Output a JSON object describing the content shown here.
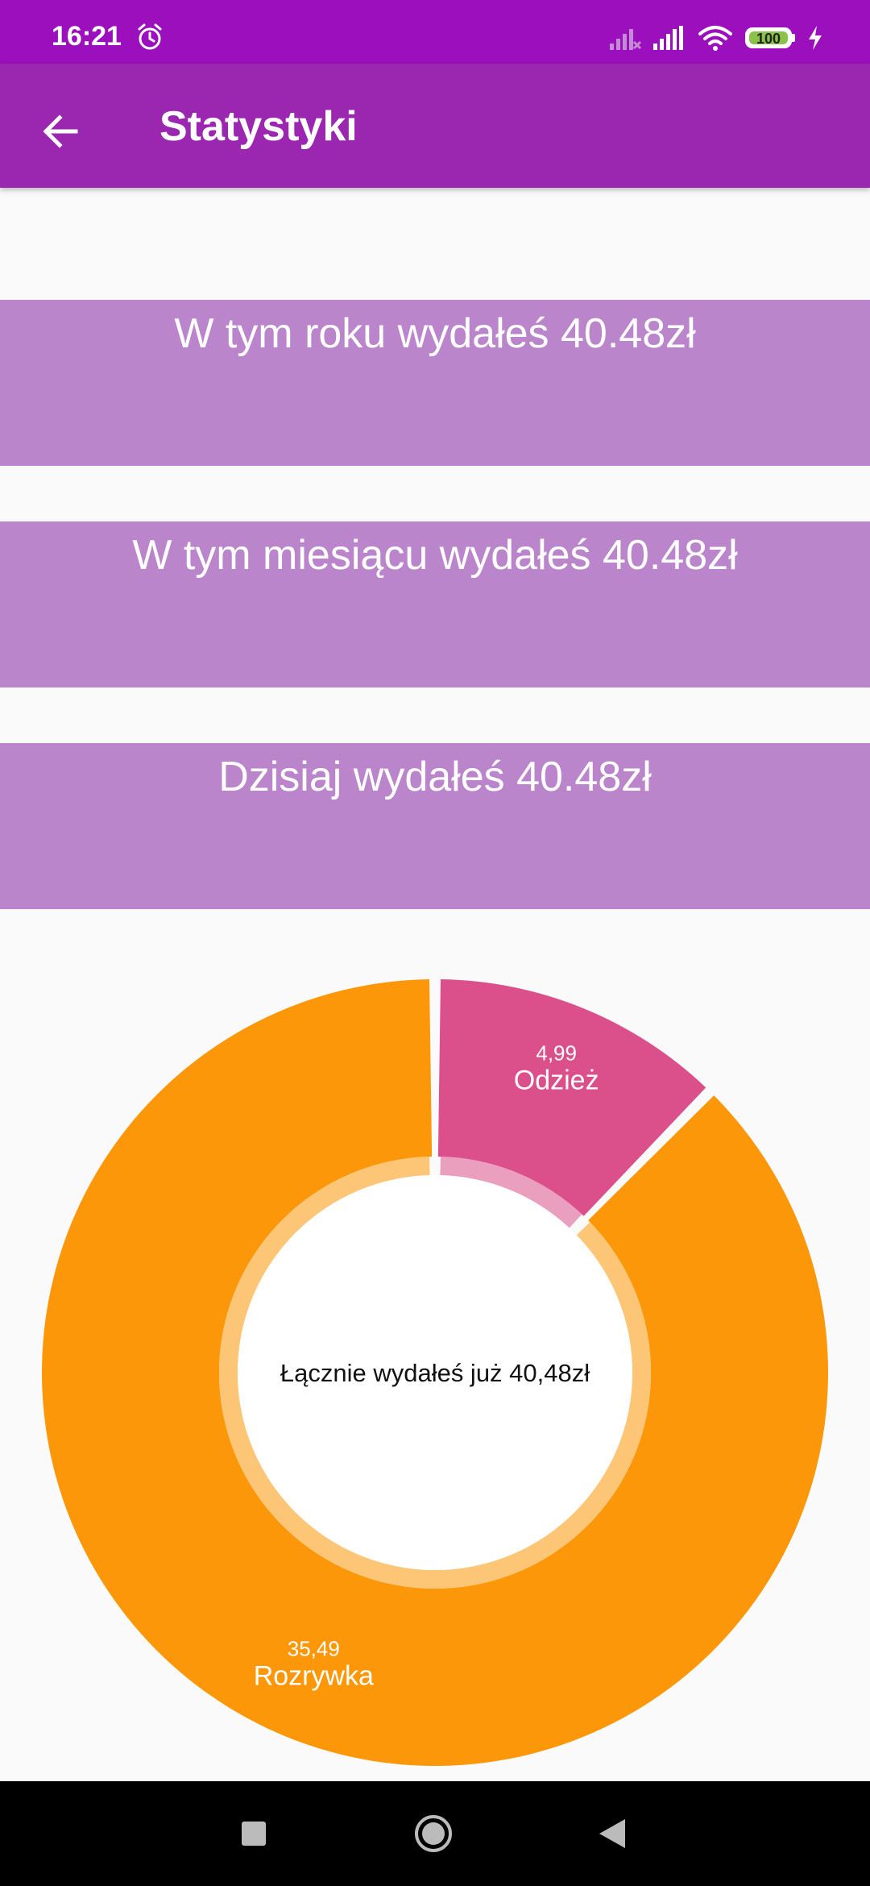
{
  "status_bar": {
    "time": "16:21",
    "battery": "100",
    "icons": [
      "alarm-icon",
      "signal-off-icon",
      "signal-icon",
      "wifi-icon",
      "battery-icon",
      "charging-icon"
    ]
  },
  "app_bar": {
    "title": "Statystyki",
    "back_icon": "arrow-back-icon"
  },
  "cards": {
    "year": "W tym roku wydałeś 40.48zł",
    "month": "W tym miesiącu wydałeś 40.48zł",
    "today": "Dzisiaj wydałeś 40.48zł"
  },
  "chart_data": {
    "type": "pie",
    "donut": true,
    "center_label": "Łącznie wydałeś już 40,48zł",
    "slices": [
      {
        "name": "Odzież",
        "value": 4.99,
        "value_label": "4,99",
        "color": "#db508a"
      },
      {
        "name": "Rozrywka",
        "value": 35.49,
        "value_label": "35,49",
        "color": "#fb9708"
      }
    ]
  },
  "nav_bar": {
    "icons": [
      "recents-icon",
      "home-icon",
      "back-icon"
    ]
  }
}
